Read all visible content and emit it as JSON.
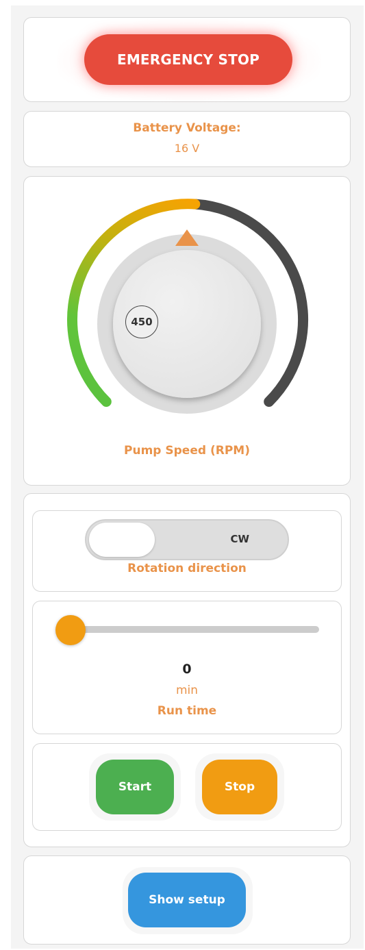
{
  "emergency": {
    "label": "EMERGENCY STOP",
    "color": "#e64b3c"
  },
  "battery": {
    "label": "Battery Voltage:",
    "value": "16 V"
  },
  "pump": {
    "label": "Pump Speed (RPM)",
    "value": "450",
    "level": 0.5,
    "gauge_colors": {
      "start": "#5bc23e",
      "mid": "#c4b10f",
      "end": "#f5a303",
      "remaining": "#4a4a4a"
    }
  },
  "rotation": {
    "state": "CW",
    "label": "Rotation direction"
  },
  "run_time": {
    "value": "0",
    "unit": "min",
    "label": "Run time",
    "slider_level": 0
  },
  "controls": {
    "start_label": "Start",
    "stop_label": "Stop",
    "start_color": "#4caf50",
    "stop_color": "#f19c12"
  },
  "setup": {
    "label": "Show setup",
    "color": "#3596de"
  },
  "accent_color": "#e9934a"
}
